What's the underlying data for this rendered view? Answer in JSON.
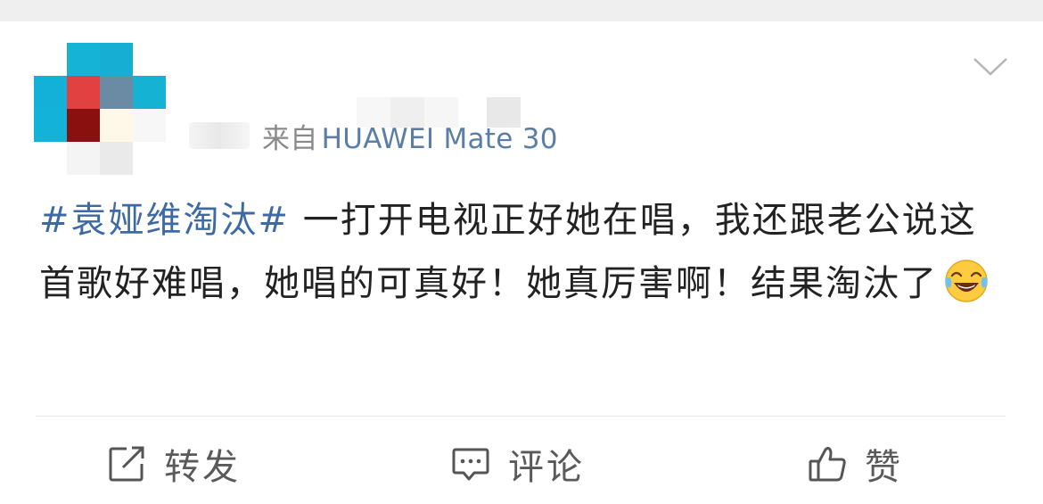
{
  "post": {
    "source_prefix": "来自",
    "source_device": "HUAWEI Mate 30",
    "hashtag": "#袁娅维淘汰#",
    "body": " 一打开电视正好她在唱，我还跟老公说这首歌好难唱，她唱的可真好！她真厉害啊！结果淘汰了",
    "emoji": "laugh-cry-emoji"
  },
  "actions": {
    "repost": "转发",
    "comment": "评论",
    "like": "赞"
  },
  "colors": {
    "hashtag": "#3d6aa5",
    "device": "#5b7ea4",
    "text": "#222222",
    "meta": "#8a8a8a"
  }
}
